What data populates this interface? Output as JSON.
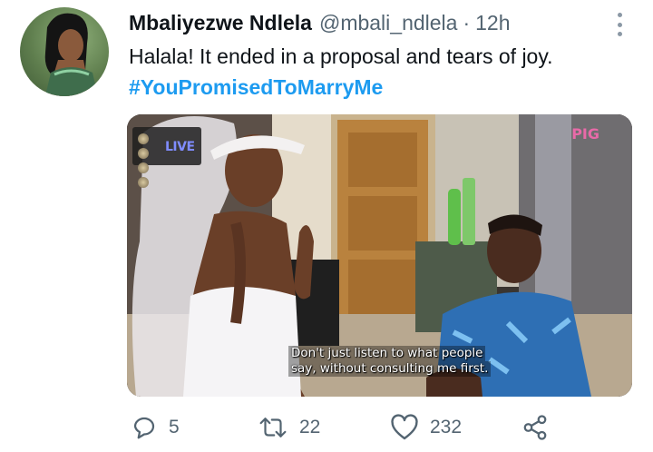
{
  "tweet": {
    "display_name": "Mbaliyezwe Ndlela",
    "handle": "@mbali_ndlela",
    "separator": "·",
    "time": "12h",
    "text": "Halala! It ended in a proposal and tears of joy.",
    "hashtag": "#YouPromisedToMarryMe"
  },
  "media": {
    "channel_badge": "LIVE",
    "watermark": "PIG",
    "subtitle_line1": "Don't just listen to what people",
    "subtitle_line2": "say, without consulting me first."
  },
  "actions": {
    "reply_count": "5",
    "retweet_count": "22",
    "like_count": "232"
  },
  "colors": {
    "link": "#1d9bf0",
    "muted": "#536471",
    "text": "#0f1419"
  }
}
